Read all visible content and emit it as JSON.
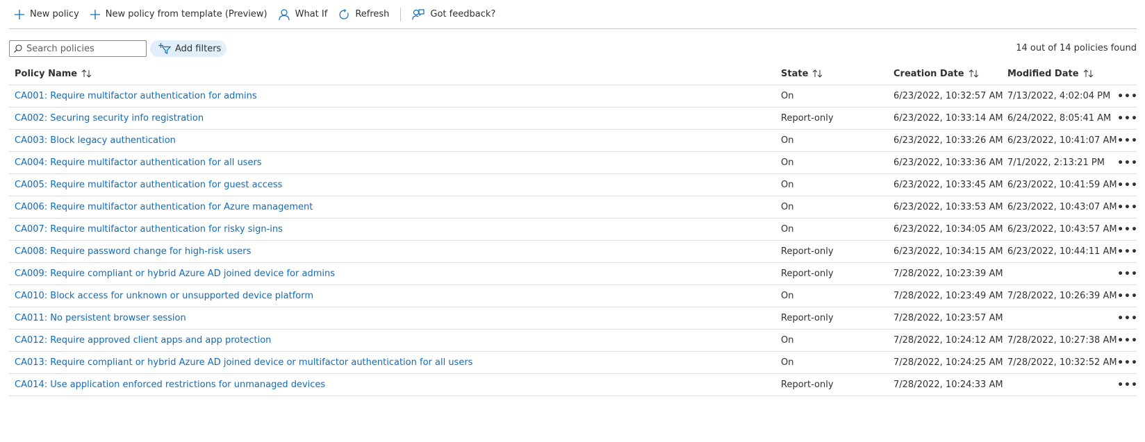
{
  "toolbar": {
    "new_policy": "New policy",
    "new_policy_template": "New policy from template (Preview)",
    "what_if": "What If",
    "refresh": "Refresh",
    "feedback": "Got feedback?"
  },
  "filters": {
    "search_placeholder": "Search policies",
    "search_value": "",
    "add_filters": "Add filters",
    "result_count": "14 out of 14 policies found"
  },
  "columns": {
    "name": "Policy Name",
    "state": "State",
    "created": "Creation Date",
    "modified": "Modified Date"
  },
  "policies": [
    {
      "name": "CA001: Require multifactor authentication for admins",
      "state": "On",
      "created": "6/23/2022, 10:32:57 AM",
      "modified": "7/13/2022, 4:02:04 PM"
    },
    {
      "name": "CA002: Securing security info registration",
      "state": "Report-only",
      "created": "6/23/2022, 10:33:14 AM",
      "modified": "6/24/2022, 8:05:41 AM"
    },
    {
      "name": "CA003: Block legacy authentication",
      "state": "On",
      "created": "6/23/2022, 10:33:26 AM",
      "modified": "6/23/2022, 10:41:07 AM"
    },
    {
      "name": "CA004: Require multifactor authentication for all users",
      "state": "On",
      "created": "6/23/2022, 10:33:36 AM",
      "modified": "7/1/2022, 2:13:21 PM"
    },
    {
      "name": "CA005: Require multifactor authentication for guest access",
      "state": "On",
      "created": "6/23/2022, 10:33:45 AM",
      "modified": "6/23/2022, 10:41:59 AM"
    },
    {
      "name": "CA006: Require multifactor authentication for Azure management",
      "state": "On",
      "created": "6/23/2022, 10:33:53 AM",
      "modified": "6/23/2022, 10:43:07 AM"
    },
    {
      "name": "CA007: Require multifactor authentication for risky sign-ins",
      "state": "On",
      "created": "6/23/2022, 10:34:05 AM",
      "modified": "6/23/2022, 10:43:57 AM"
    },
    {
      "name": "CA008: Require password change for high-risk users",
      "state": "Report-only",
      "created": "6/23/2022, 10:34:15 AM",
      "modified": "6/23/2022, 10:44:11 AM"
    },
    {
      "name": "CA009: Require compliant or hybrid Azure AD joined device for admins",
      "state": "Report-only",
      "created": "7/28/2022, 10:23:39 AM",
      "modified": ""
    },
    {
      "name": "CA010: Block access for unknown or unsupported device platform",
      "state": "On",
      "created": "7/28/2022, 10:23:49 AM",
      "modified": "7/28/2022, 10:26:39 AM"
    },
    {
      "name": "CA011: No persistent browser session",
      "state": "Report-only",
      "created": "7/28/2022, 10:23:57 AM",
      "modified": ""
    },
    {
      "name": "CA012: Require approved client apps and app protection",
      "state": "On",
      "created": "7/28/2022, 10:24:12 AM",
      "modified": "7/28/2022, 10:27:38 AM"
    },
    {
      "name": "CA013: Require compliant or hybrid Azure AD joined device or multifactor authentication for all users",
      "state": "On",
      "created": "7/28/2022, 10:24:25 AM",
      "modified": "7/28/2022, 10:32:52 AM"
    },
    {
      "name": "CA014: Use application enforced restrictions for unmanaged devices",
      "state": "Report-only",
      "created": "7/28/2022, 10:24:33 AM",
      "modified": ""
    }
  ],
  "row_more_label": "•••",
  "colors": {
    "accent": "#0f6cbd",
    "text": "#323130",
    "border": "#e1dfdd",
    "filter_pill": "#e1eefb"
  },
  "icons": {
    "new_policy": "plus-icon",
    "new_policy_template": "plus-icon",
    "what_if": "person-icon",
    "refresh": "refresh-icon",
    "feedback": "feedback-icon",
    "search": "search-icon",
    "add_filters": "add-filter-icon",
    "sort": "sort-icon",
    "row_more": "more-icon"
  }
}
